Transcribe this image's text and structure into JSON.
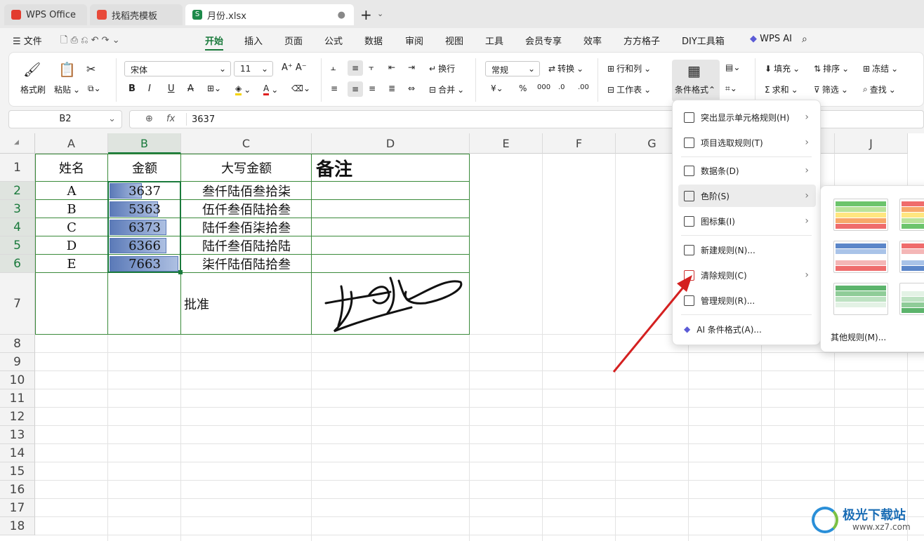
{
  "tabs": [
    {
      "label": "WPS Office"
    },
    {
      "label": "找稻壳模板"
    },
    {
      "label": "月份.xlsx"
    }
  ],
  "menubar": {
    "file": "文件",
    "items": [
      "开始",
      "插入",
      "页面",
      "公式",
      "数据",
      "审阅",
      "视图",
      "工具",
      "会员专享",
      "效率",
      "方方格子",
      "DIY工具箱"
    ],
    "ai": "WPS AI"
  },
  "ribbon": {
    "format_painter": "格式刷",
    "paste": "粘贴",
    "font": "宋体",
    "size": "11",
    "wrap": "换行",
    "merge": "合并",
    "number_format": "常规",
    "convert": "转换",
    "row_col": "行和列",
    "worksheet": "工作表",
    "cond_format": "条件格式",
    "fill": "填充",
    "sort": "排序",
    "freeze": "冻结",
    "sum": "求和",
    "filter": "筛选",
    "find": "查找"
  },
  "formula": {
    "cell_ref": "B2",
    "fx": "fx",
    "value": "3637"
  },
  "columns": [
    "A",
    "B",
    "C",
    "D",
    "E",
    "F",
    "G",
    "H",
    "I",
    "J"
  ],
  "rows": [
    "1",
    "2",
    "3",
    "4",
    "5",
    "6",
    "7",
    "8",
    "9",
    "10",
    "11",
    "12",
    "13",
    "14",
    "15",
    "16",
    "17",
    "18"
  ],
  "headers": {
    "name": "姓名",
    "amount": "金额",
    "upper": "大写金额",
    "note": "备注"
  },
  "data": [
    {
      "name": "A",
      "amount": "3637",
      "upper": "叁仟陆佰叁拾柒",
      "fill": 0.47
    },
    {
      "name": "B",
      "amount": "5363",
      "upper": "伍仟叁佰陆拾叁",
      "fill": 0.7
    },
    {
      "name": "C",
      "amount": "6373",
      "upper": "陆仟叁佰柒拾叁",
      "fill": 0.83
    },
    {
      "name": "D",
      "amount": "6366",
      "upper": "陆仟叁佰陆拾陆",
      "fill": 0.83
    },
    {
      "name": "E",
      "amount": "7663",
      "upper": "柒仟陆佰陆拾叁",
      "fill": 1.0
    }
  ],
  "approve": "批准",
  "cf_menu": [
    "突出显示单元格规则(H)",
    "项目选取规则(T)",
    "数据条(D)",
    "色阶(S)",
    "图标集(I)",
    "新建规则(N)...",
    "清除规则(C)",
    "管理规则(R)...",
    "AI 条件格式(A)..."
  ],
  "submenu": {
    "other": "其他规则(M)..."
  },
  "watermark": "极光下载站",
  "watermark_url": "www.xz7.com"
}
